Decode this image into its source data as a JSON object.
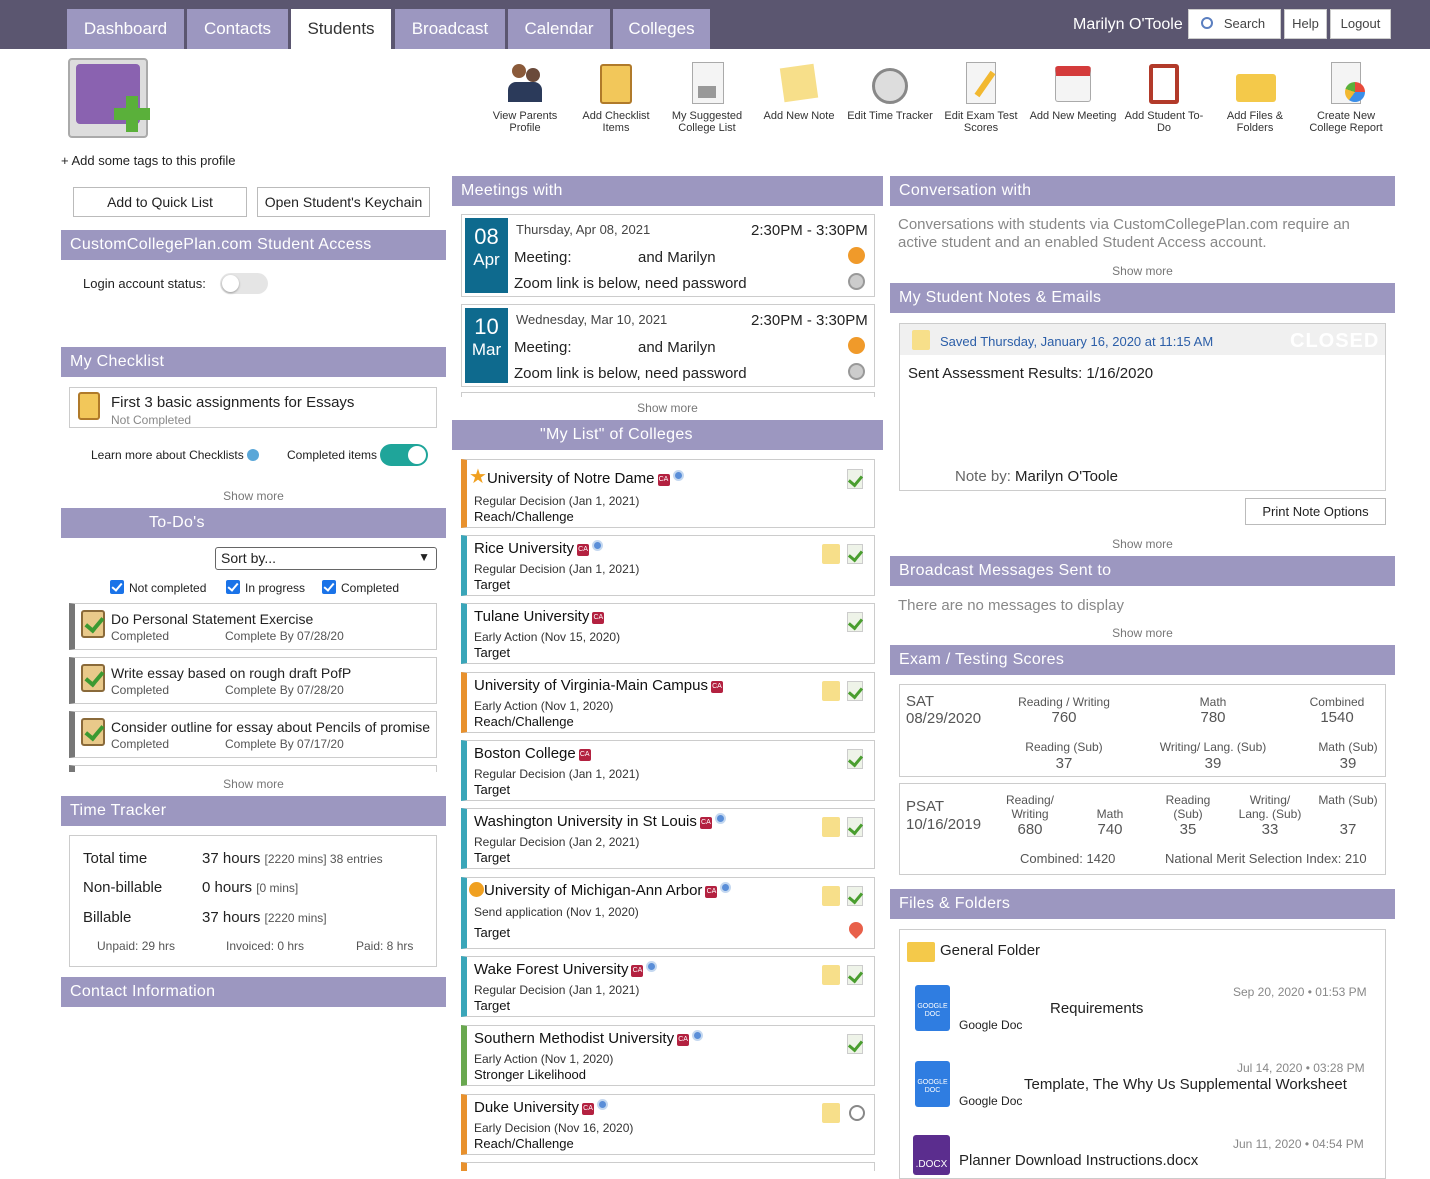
{
  "nav": {
    "tabs": [
      "Dashboard",
      "Contacts",
      "Students",
      "Broadcast",
      "Calendar",
      "Colleges"
    ],
    "user": "Marilyn O'Toole",
    "search": "Search",
    "help": "Help",
    "logout": "Logout"
  },
  "profile": {
    "tags": "+ Add some tags to this profile",
    "quick_list": "Add to Quick List",
    "keychain": "Open Student's Keychain"
  },
  "tools": [
    "View Parents Profile",
    "Add Checklist Items",
    "My Suggested College List",
    "Add New Note",
    "Edit Time Tracker",
    "Edit Exam Test Scores",
    "Add New Meeting",
    "Add Student To-Do",
    "Add Files & Folders",
    "Create New College Report"
  ],
  "access": {
    "title": "CustomCollegePlan.com Student Access",
    "login_label": "Login account status:"
  },
  "checklist": {
    "title": "My Checklist",
    "item": "First 3 basic assignments for Essays",
    "status": "Not Completed",
    "learn": "Learn more about Checklists",
    "completed": "Completed items",
    "show_more": "Show more"
  },
  "todos": {
    "title": "To-Do's",
    "sort": "Sort by...",
    "filters": [
      "Not completed",
      "In progress",
      "Completed"
    ],
    "items": [
      {
        "title": "Do Personal Statement Exercise",
        "status": "Completed",
        "due": "Complete By 07/28/20"
      },
      {
        "title": "Write essay based on rough draft PofP",
        "status": "Completed",
        "due": "Complete By 07/28/20"
      },
      {
        "title": "Consider outline for essay about Pencils of promise",
        "status": "Completed",
        "due": "Complete By 07/17/20"
      }
    ],
    "show_more": "Show more"
  },
  "time": {
    "title": "Time Tracker",
    "total_label": "Total time",
    "total": "37 hours",
    "total_note": "[2220 mins] 38 entries",
    "nonbill_label": "Non-billable",
    "nonbill": "0 hours",
    "nonbill_note": "[0 mins]",
    "bill_label": "Billable",
    "bill": "37 hours",
    "bill_note": "[2220 mins]",
    "unpaid": "Unpaid: 29 hrs",
    "invoiced": "Invoiced: 0 hrs",
    "paid": "Paid: 8 hrs"
  },
  "contact": {
    "title": "Contact Information"
  },
  "meetings": {
    "title": "Meetings with",
    "items": [
      {
        "day": "08",
        "mon": "Apr",
        "date": "Thursday, Apr 08, 2021",
        "time": "2:30PM - 3:30PM",
        "meeting": "Meeting:",
        "with": "and Marilyn",
        "note": "Zoom link is below, need password"
      },
      {
        "day": "10",
        "mon": "Mar",
        "date": "Wednesday, Mar 10, 2021",
        "time": "2:30PM - 3:30PM",
        "meeting": "Meeting:",
        "with": "and Marilyn",
        "note": "Zoom link is below, need password"
      }
    ],
    "show_more": "Show more"
  },
  "colleges": {
    "title": "\"My List\" of Colleges",
    "items": [
      {
        "name": "University of Notre Dame",
        "decision": "Regular Decision (Jan 1, 2021)",
        "category": "Reach/Challenge"
      },
      {
        "name": "Rice University",
        "decision": "Regular Decision (Jan 1, 2021)",
        "category": "Target"
      },
      {
        "name": "Tulane University",
        "decision": "Early Action (Nov 15, 2020)",
        "category": "Target"
      },
      {
        "name": "University of Virginia-Main Campus",
        "decision": "Early Action (Nov 1, 2020)",
        "category": "Reach/Challenge"
      },
      {
        "name": "Boston College",
        "decision": "Regular Decision (Jan 1, 2021)",
        "category": "Target"
      },
      {
        "name": "Washington University in St Louis",
        "decision": "Regular Decision (Jan 2, 2021)",
        "category": "Target"
      },
      {
        "name": "University of Michigan-Ann Arbor",
        "decision": "Send application (Nov 1, 2020)",
        "category": "Target"
      },
      {
        "name": "Wake Forest University",
        "decision": "Regular Decision (Jan 1, 2021)",
        "category": "Target"
      },
      {
        "name": "Southern Methodist University",
        "decision": "Early Action (Nov 1, 2020)",
        "category": "Stronger Likelihood"
      },
      {
        "name": "Duke University",
        "decision": "Early Decision (Nov 16, 2020)",
        "category": "Reach/Challenge"
      }
    ]
  },
  "conversation": {
    "title": "Conversation with",
    "text": "Conversations with students via CustomCollegePlan.com require an active student and an enabled Student Access account.",
    "show_more": "Show more"
  },
  "notes": {
    "title": "My Student Notes & Emails",
    "saved": "Saved Thursday, January 16, 2020 at 11:15 AM",
    "closed": "CLOSED",
    "body": "Sent Assessment Results: 1/16/2020",
    "by_label": "Note by:",
    "by": "Marilyn O'Toole",
    "print": "Print Note Options",
    "show_more": "Show more"
  },
  "broadcast": {
    "title": "Broadcast Messages Sent to",
    "empty": "There are no messages to display",
    "show_more": "Show more"
  },
  "exams": {
    "title": "Exam / Testing Scores",
    "sat": {
      "name": "SAT",
      "date": "08/29/2020",
      "rw_label": "Reading / Writing",
      "rw": "760",
      "math_label": "Math",
      "math": "780",
      "comb_label": "Combined",
      "comb": "1540",
      "rs_label": "Reading (Sub)",
      "rs": "37",
      "wl_label": "Writing/ Lang. (Sub)",
      "wl": "39",
      "ms_label": "Math (Sub)",
      "ms": "39"
    },
    "psat": {
      "name": "PSAT",
      "date": "10/16/2019",
      "rw_label": "Reading/ Writing",
      "rw": "680",
      "math_label": "Math",
      "math": "740",
      "rs_label": "Reading (Sub)",
      "rs": "35",
      "wl_label": "Writing/ Lang. (Sub)",
      "wl": "33",
      "ms_label": "Math (Sub)",
      "ms": "37",
      "combined": "Combined: 1420",
      "nmsi": "National Merit Selection Index: 210"
    }
  },
  "files": {
    "title": "Files & Folders",
    "folder": "General Folder",
    "items": [
      {
        "name": "Requirements",
        "type": "Google Doc",
        "date": "Sep 20, 2020 • 01:53 PM"
      },
      {
        "name": "Template, The Why Us Supplemental Worksheet",
        "type": "Google Doc",
        "date": "Jul 14, 2020 • 03:28 PM"
      },
      {
        "name": "Planner Download Instructions.docx",
        "type": "",
        "date": "Jun 11, 2020 • 04:54 PM"
      }
    ]
  },
  "colors": {
    "nav": "#5b5670",
    "header": "#9c97c0",
    "date": "#0e6a8e",
    "reach": "#e8912d",
    "target": "#3aa6b9",
    "likely": "#69a84f"
  }
}
